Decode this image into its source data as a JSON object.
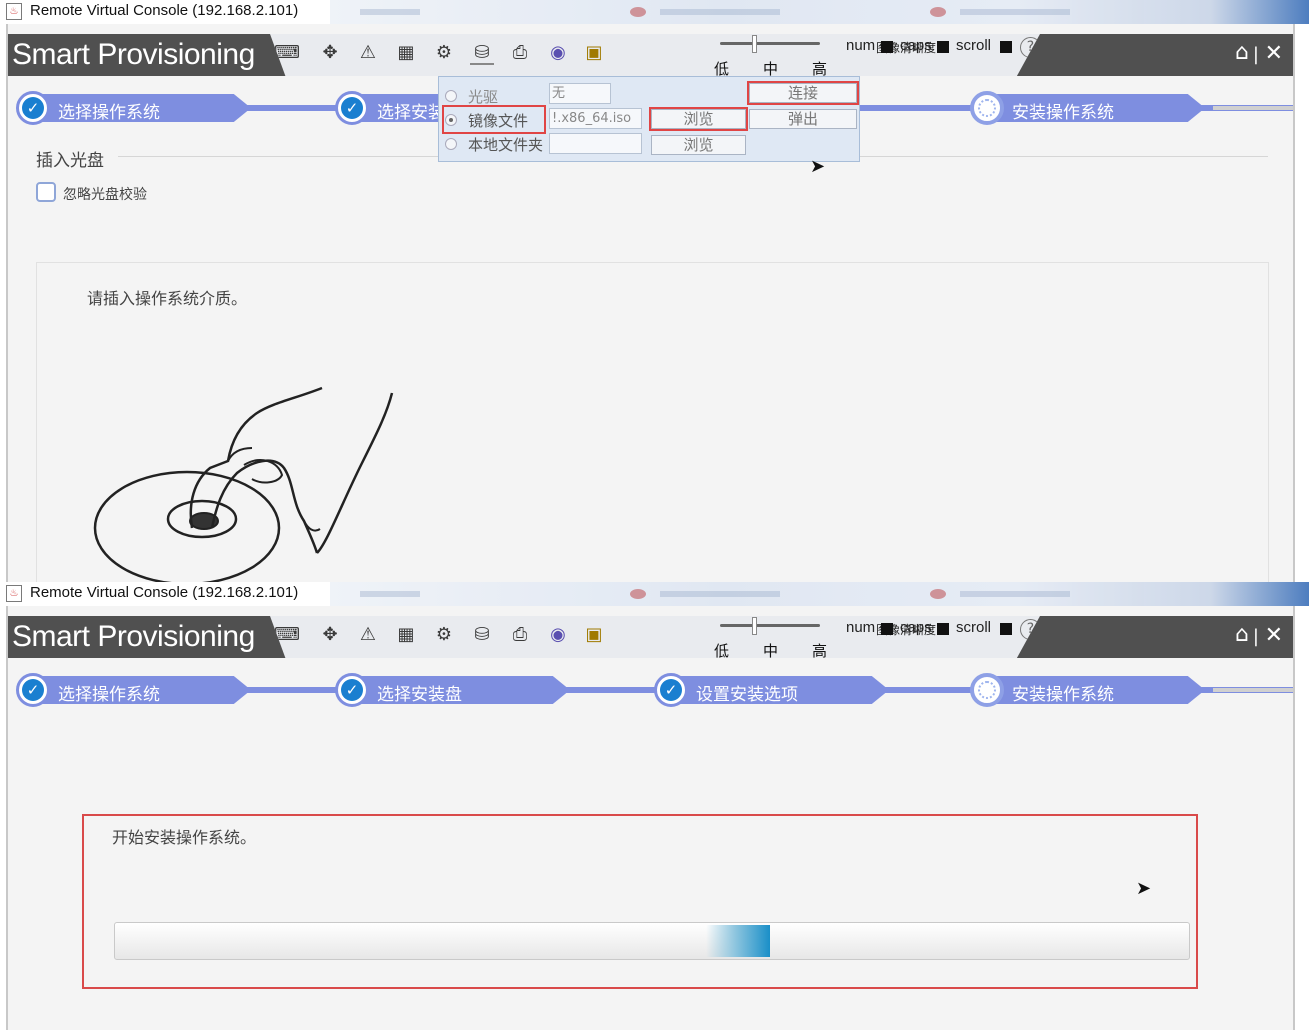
{
  "window": {
    "title": "Remote Virtual Console (192.168.2.101)",
    "app_icon": "java-icon"
  },
  "toolbar": {
    "brand": "Smart Provisioning",
    "icons": [
      "keyboard-icon",
      "move-icon",
      "mouse-icon",
      "screenshot-icon",
      "power-icon",
      "virtual-media-icon",
      "floppy-icon",
      "cdrom-icon",
      "video-icon"
    ],
    "quality_label": "图像清晰度",
    "quality_levels": [
      "低",
      "中",
      "高"
    ],
    "quality_selected": "中",
    "locks": [
      "num",
      "caps",
      "scroll"
    ],
    "help": "?",
    "home_icon": "home-icon",
    "separator": "|",
    "close_icon": "close-icon",
    "close_glyph": "✕"
  },
  "steps": [
    {
      "label": "选择操作系统",
      "state": "done"
    },
    {
      "label": "选择安装盘",
      "state": "done"
    },
    {
      "label": "设置安装选项",
      "state": "done"
    },
    {
      "label": "安装操作系统",
      "state": "current"
    }
  ],
  "step2_partial_label": "选择安装",
  "media_popup": {
    "rows": [
      {
        "label": "光驱",
        "value": "无",
        "selected": false
      },
      {
        "label": "镜像文件",
        "value": "!.x86_64.iso",
        "selected": true
      },
      {
        "label": "本地文件夹",
        "value": "",
        "selected": false
      }
    ],
    "browse_label": "浏览",
    "connect_label": "连接",
    "eject_label": "弹出"
  },
  "screen1": {
    "section_title": "插入光盘",
    "checkbox_label": "忽略光盘校验",
    "checkbox_checked": false,
    "message": "请插入操作系统介质。"
  },
  "screen2": {
    "message": "开始安装操作系统。",
    "progress": 0.06
  },
  "colors": {
    "accent": "#7e8ee0",
    "check": "#1a7fd0",
    "highlight": "#e04545",
    "toolbar": "#505050"
  }
}
